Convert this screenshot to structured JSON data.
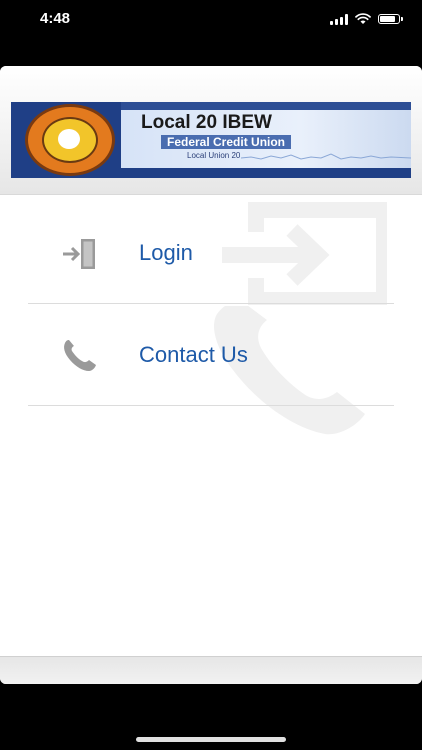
{
  "status_bar": {
    "time": "4:48",
    "battery_level": 0.9
  },
  "header": {
    "banner_title": "Local 20 IBEW",
    "banner_subtitle": "Federal Credit Union",
    "banner_caption": "Local Union 20",
    "logo": "ibew-seal-logo"
  },
  "menu": [
    {
      "label": "Login",
      "icon": "login-door-icon"
    },
    {
      "label": "Contact Us",
      "icon": "phone-icon"
    }
  ],
  "colors": {
    "link": "#1e5aa8",
    "icon_gray": "#9a9a9a",
    "watermark": "#f0f0f0",
    "banner_blue": "#1f3f86"
  }
}
